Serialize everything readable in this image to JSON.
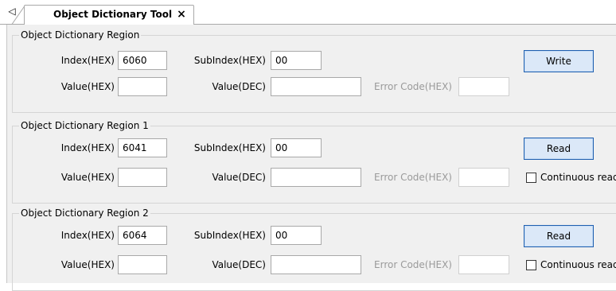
{
  "tab": {
    "label": "Object Dictionary Tool",
    "close": "×",
    "scroll_left": "◁"
  },
  "groups": [
    {
      "title": "Object Dictionary Region",
      "index_label": "Index(HEX)",
      "index_value": "6060",
      "subindex_label": "SubIndex(HEX)",
      "subindex_value": "00",
      "value_hex_label": "Value(HEX)",
      "value_hex": "",
      "value_dec_label": "Value(DEC)",
      "value_dec": "",
      "error_label": "Error Code(HEX)",
      "error_value": "",
      "button": "Write"
    },
    {
      "title": "Object Dictionary Region 1",
      "index_label": "Index(HEX)",
      "index_value": "6041",
      "subindex_label": "SubIndex(HEX)",
      "subindex_value": "00",
      "value_hex_label": "Value(HEX)",
      "value_hex": "",
      "value_dec_label": "Value(DEC)",
      "value_dec": "",
      "error_label": "Error Code(HEX)",
      "error_value": "",
      "button": "Read",
      "checkbox_label": "Continuous read",
      "checkbox_checked": false
    },
    {
      "title": "Object Dictionary Region 2",
      "index_label": "Index(HEX)",
      "index_value": "6064",
      "subindex_label": "SubIndex(HEX)",
      "subindex_value": "00",
      "value_hex_label": "Value(HEX)",
      "value_hex": "",
      "value_dec_label": "Value(DEC)",
      "value_dec": "",
      "error_label": "Error Code(HEX)",
      "error_value": "",
      "button": "Read",
      "checkbox_label": "Continuous read",
      "checkbox_checked": false
    }
  ]
}
